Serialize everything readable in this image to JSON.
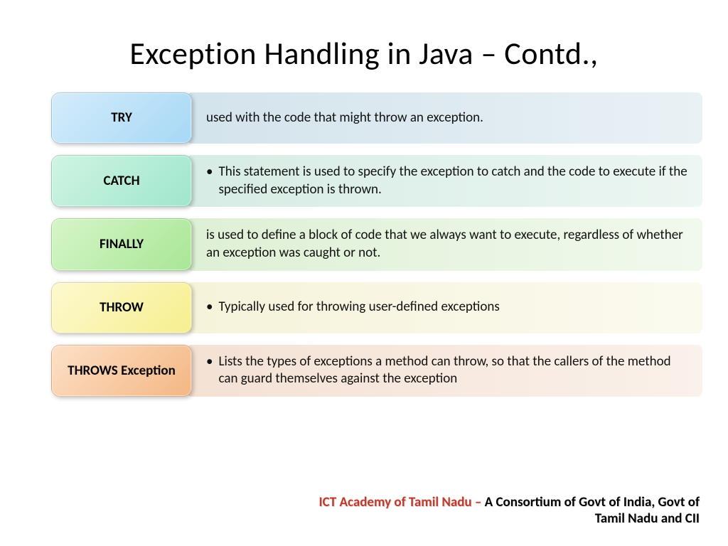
{
  "title": "Exception Handling in Java – Contd.,",
  "rows": [
    {
      "label": "TRY",
      "bullet": false,
      "desc": "used with the code that might throw an exception."
    },
    {
      "label": "CATCH",
      "bullet": true,
      "desc": "This statement is used to specify the exception to catch and the code to execute if the specified exception is thrown."
    },
    {
      "label": "FINALLY",
      "bullet": false,
      "desc": "is used to define a block of code that we always want to execute, regardless of whether an exception was caught or not."
    },
    {
      "label": "THROW",
      "bullet": true,
      "desc": "Typically used for throwing user-defined exceptions"
    },
    {
      "label": "THROWS Exception",
      "bullet": true,
      "desc": "Lists the types of exceptions a method can throw, so that the callers of the method can guard themselves against the exception"
    }
  ],
  "footer": {
    "org": "ICT Academy of Tamil Nadu – ",
    "rest": "A Consortium of Govt of India, Govt of Tamil Nadu and CII"
  }
}
